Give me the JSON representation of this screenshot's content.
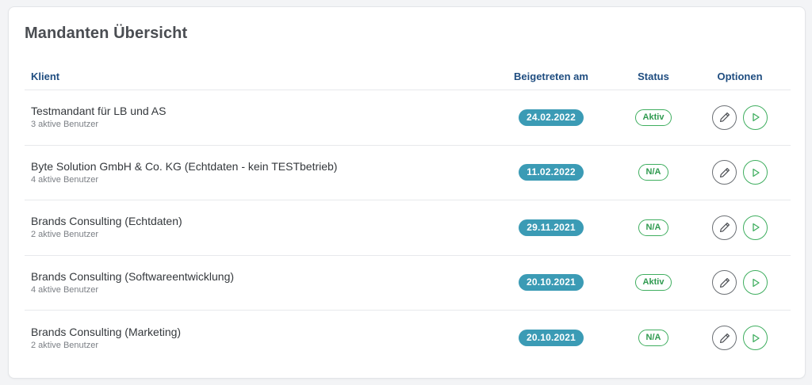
{
  "title": "Mandanten Übersicht",
  "columns": {
    "client": "Klient",
    "joined": "Beigetreten am",
    "status": "Status",
    "options": "Optionen"
  },
  "colors": {
    "header_text": "#1f4d80",
    "date_pill": "#3b9bb5",
    "status_green": "#3fae5f",
    "edit_icon": "#6b6f74"
  },
  "icons": {
    "edit": "pencil-icon",
    "open": "play-icon"
  },
  "rows": [
    {
      "name": "Testmandant für LB und AS",
      "users": "3 aktive Benutzer",
      "date": "24.02.2022",
      "status": "Aktiv"
    },
    {
      "name": "Byte Solution GmbH & Co. KG (Echtdaten - kein TESTbetrieb)",
      "users": "4 aktive Benutzer",
      "date": "11.02.2022",
      "status": "N/A"
    },
    {
      "name": "Brands Consulting (Echtdaten)",
      "users": "2 aktive Benutzer",
      "date": "29.11.2021",
      "status": "N/A"
    },
    {
      "name": "Brands Consulting (Softwareentwicklung)",
      "users": "4 aktive Benutzer",
      "date": "20.10.2021",
      "status": "Aktiv"
    },
    {
      "name": "Brands Consulting (Marketing)",
      "users": "2 aktive Benutzer",
      "date": "20.10.2021",
      "status": "N/A"
    }
  ]
}
